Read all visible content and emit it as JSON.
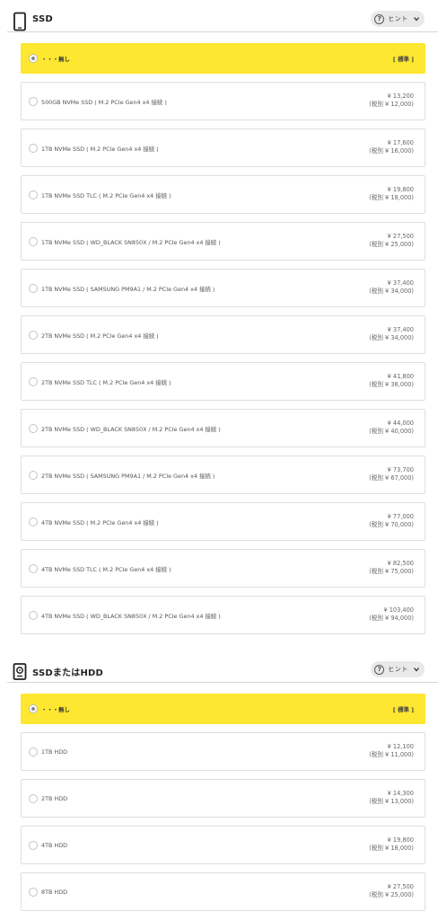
{
  "sections": [
    {
      "title": "SSD",
      "icon": "tablet-icon",
      "hint_label": "ヒント",
      "hint_q": "?",
      "default": {
        "label": "・・・無し",
        "tag": "[ 標準 ]"
      },
      "options": [
        {
          "label": "500GB NVMe SSD ( M.2 PCIe Gen4 x4 接続 )",
          "price": "¥ 13,200",
          "price_ex": "(税別 ¥ 12,000)"
        },
        {
          "label": "1TB NVMe SSD ( M.2 PCIe Gen4 x4 接続 )",
          "price": "¥ 17,600",
          "price_ex": "(税別 ¥ 16,000)"
        },
        {
          "label": "1TB NVMe SSD TLC ( M.2 PCIe Gen4 x4 接続 )",
          "price": "¥ 19,800",
          "price_ex": "(税別 ¥ 18,000)"
        },
        {
          "label": "1TB NVMe SSD ( WD_BLACK SN850X / M.2 PCIe Gen4 x4 接続 )",
          "price": "¥ 27,500",
          "price_ex": "(税別 ¥ 25,000)"
        },
        {
          "label": "1TB NVMe SSD ( SAMSUNG PM9A1 / M.2 PCIe Gen4 x4 接続 )",
          "price": "¥ 37,400",
          "price_ex": "(税別 ¥ 34,000)"
        },
        {
          "label": "2TB NVMe SSD ( M.2 PCIe Gen4 x4 接続 )",
          "price": "¥ 37,400",
          "price_ex": "(税別 ¥ 34,000)"
        },
        {
          "label": "2TB NVMe SSD TLC ( M.2 PCIe Gen4 x4 接続 )",
          "price": "¥ 41,800",
          "price_ex": "(税別 ¥ 38,000)"
        },
        {
          "label": "2TB NVMe SSD ( WD_BLACK SN850X / M.2 PCIe Gen4 x4 接続 )",
          "price": "¥ 44,000",
          "price_ex": "(税別 ¥ 40,000)"
        },
        {
          "label": "2TB NVMe SSD ( SAMSUNG PM9A1 / M.2 PCIe Gen4 x4 接続 )",
          "price": "¥ 73,700",
          "price_ex": "(税別 ¥ 67,000)"
        },
        {
          "label": "4TB NVMe SSD ( M.2 PCIe Gen4 x4 接続 )",
          "price": "¥ 77,000",
          "price_ex": "(税別 ¥ 70,000)"
        },
        {
          "label": "4TB NVMe SSD TLC ( M.2 PCIe Gen4 x4 接続 )",
          "price": "¥ 82,500",
          "price_ex": "(税別 ¥ 75,000)"
        },
        {
          "label": "4TB NVMe SSD ( WD_BLACK SN850X / M.2 PCIe Gen4 x4 接続 )",
          "price": "¥ 103,400",
          "price_ex": "(税別 ¥ 94,000)"
        }
      ]
    },
    {
      "title": "SSDまたはHDD",
      "icon": "hard-drive-icon",
      "hint_label": "ヒント",
      "hint_q": "?",
      "default": {
        "label": "・・・無し",
        "tag": "[ 標準 ]"
      },
      "options": [
        {
          "label": "1TB HDD",
          "price": "¥ 12,100",
          "price_ex": "(税別 ¥ 11,000)"
        },
        {
          "label": "2TB HDD",
          "price": "¥ 14,300",
          "price_ex": "(税別 ¥ 13,000)"
        },
        {
          "label": "4TB HDD",
          "price": "¥ 19,800",
          "price_ex": "(税別 ¥ 18,000)"
        },
        {
          "label": "8TB HDD",
          "price": "¥ 27,500",
          "price_ex": "(税別 ¥ 25,000)"
        }
      ]
    }
  ],
  "colors": {
    "selected_bg": "#fde730",
    "border": "#dedede",
    "hint_bg": "#e9e9e9"
  }
}
